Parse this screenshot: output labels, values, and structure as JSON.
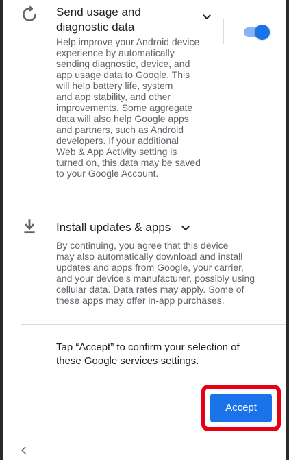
{
  "usage_section": {
    "icon": "sync-icon",
    "title": "Send usage and\ndiagnostic data",
    "body": "Help improve your Android device\nexperience by automatically\nsending diagnostic, device, and\napp usage data to Google. This\nwill help battery life, system\nand app stability, and other\nimprovements. Some aggregate\ndata will also help Google apps\nand partners, such as Android\ndevelopers. If your additional\nWeb & App Activity setting is\nturned on, this data may be saved\nto your Google Account.",
    "toggle_on": true
  },
  "updates_section": {
    "icon": "download-icon",
    "title": "Install updates & apps",
    "body": "By continuing, you agree that this device\nmay also automatically download and install\nupdates and apps from Google, your carrier,\nand your device’s manufacturer, possibly using\ncellular data. Data rates may apply. Some of\nthese apps may offer in-app purchases."
  },
  "confirm_text": "Tap “Accept” to confirm your selection of\nthese Google services settings.",
  "accept_label": "Accept",
  "colors": {
    "accent": "#1a73e8",
    "highlight": "#e60012"
  }
}
